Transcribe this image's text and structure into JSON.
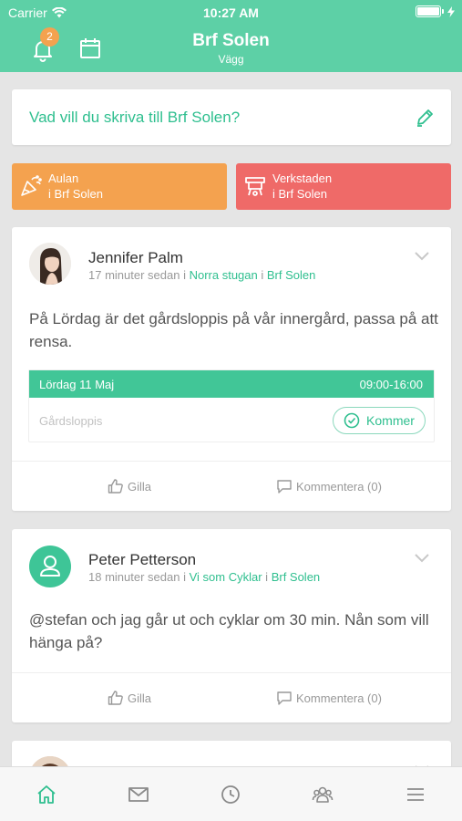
{
  "status": {
    "carrier": "Carrier",
    "time": "10:27 AM"
  },
  "header": {
    "title": "Brf Solen",
    "subtitle": "Vägg",
    "notification_count": "2"
  },
  "compose": {
    "placeholder": "Vad vill du skriva till Brf Solen?"
  },
  "groups": [
    {
      "line1": "Aulan",
      "line2": "i Brf Solen",
      "color": "#f4a24f"
    },
    {
      "line1": "Verkstaden",
      "line2": "i Brf Solen",
      "color": "#ef6a68"
    }
  ],
  "posts": [
    {
      "author": "Jennifer Palm",
      "time": "17 minuter sedan",
      "in1": "i",
      "group": "Norra stugan",
      "in2": "i",
      "association": "Brf Solen",
      "body": "På Lördag är det gårdsloppis på vår innergård, passa på att rensa.",
      "event": {
        "date": "Lördag 11 Maj",
        "time": "09:00-16:00",
        "name": "Gårdsloppis",
        "rsvp": "Kommer"
      },
      "like": "Gilla",
      "comment": "Kommentera (0)"
    },
    {
      "author": "Peter Petterson",
      "time": "18 minuter sedan",
      "in1": "i",
      "group": "Vi som Cyklar",
      "in2": "i",
      "association": "Brf Solen",
      "body": "@stefan och jag går ut och cyklar om 30 min. Nån som vill hänga på?",
      "like": "Gilla",
      "comment": "Kommentera (0)"
    }
  ],
  "tabbar": {
    "icons": [
      "home-icon",
      "mail-icon",
      "clock-icon",
      "group-icon",
      "menu-icon"
    ],
    "active_color": "#2fbf8f"
  },
  "colors": {
    "brand": "#5dd0a6",
    "accent": "#2fbf8f",
    "orange": "#f4a24f",
    "red": "#ef6a68"
  }
}
